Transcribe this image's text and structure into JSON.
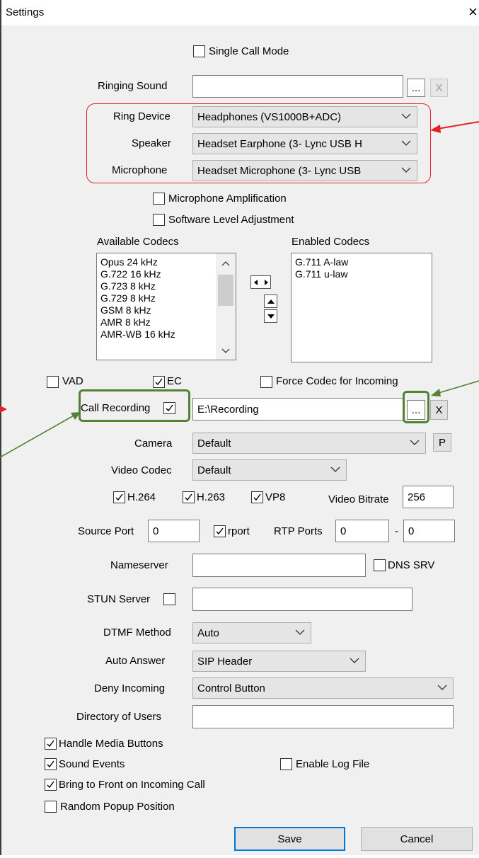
{
  "window": {
    "title": "Settings",
    "close_glyph": "×"
  },
  "single_call_mode": {
    "label": "Single Call Mode",
    "checked": false
  },
  "ringing_sound": {
    "label": "Ringing Sound",
    "value": "",
    "browse": "...",
    "clear": "X"
  },
  "ring_device": {
    "label": "Ring Device",
    "value": "Headphones (VS1000B+ADC)"
  },
  "speaker": {
    "label": "Speaker",
    "value": "Headset Earphone (3- Lync USB H"
  },
  "microphone": {
    "label": "Microphone",
    "value": "Headset Microphone (3- Lync USB"
  },
  "mic_amplification": {
    "label": "Microphone Amplification",
    "checked": false
  },
  "software_level": {
    "label": "Software Level Adjustment",
    "checked": false
  },
  "codecs": {
    "available_label": "Available Codecs",
    "enabled_label": "Enabled Codecs",
    "available": [
      "Opus 24 kHz",
      "G.722 16 kHz",
      "G.723 8 kHz",
      "G.729 8 kHz",
      "GSM 8 kHz",
      "AMR 8 kHz",
      "AMR-WB 16 kHz"
    ],
    "enabled": [
      "G.711 A-law",
      "G.711 u-law"
    ]
  },
  "vad": {
    "label": "VAD",
    "checked": false
  },
  "ec": {
    "label": "EC",
    "checked": true
  },
  "force_codec": {
    "label": "Force Codec for Incoming",
    "checked": false
  },
  "call_recording": {
    "label": "Call Recording",
    "checked": true,
    "path": "E:\\Recording",
    "browse": "...",
    "clear": "X"
  },
  "camera": {
    "label": "Camera",
    "value": "Default",
    "p_button": "P"
  },
  "video_codec": {
    "label": "Video Codec",
    "value": "Default"
  },
  "h264": {
    "label": "H.264",
    "checked": true
  },
  "h263": {
    "label": "H.263",
    "checked": true
  },
  "vp8": {
    "label": "VP8",
    "checked": true
  },
  "video_bitrate": {
    "label": "Video Bitrate",
    "value": "256"
  },
  "source_port": {
    "label": "Source Port",
    "value": "0"
  },
  "rport": {
    "label": "rport",
    "checked": true
  },
  "rtp_ports": {
    "label": "RTP Ports",
    "from": "0",
    "dash": "-",
    "to": "0"
  },
  "nameserver": {
    "label": "Nameserver",
    "value": ""
  },
  "dns_srv": {
    "label": "DNS SRV",
    "checked": false
  },
  "stun_server": {
    "label": "STUN Server",
    "checked": false,
    "value": ""
  },
  "dtmf_method": {
    "label": "DTMF Method",
    "value": "Auto"
  },
  "auto_answer": {
    "label": "Auto Answer",
    "value": "SIP Header"
  },
  "deny_incoming": {
    "label": "Deny Incoming",
    "value": "Control Button"
  },
  "directory_of_users": {
    "label": "Directory of Users",
    "value": ""
  },
  "handle_media_buttons": {
    "label": "Handle Media Buttons",
    "checked": true
  },
  "sound_events": {
    "label": "Sound Events",
    "checked": true
  },
  "enable_log_file": {
    "label": "Enable Log File",
    "checked": false
  },
  "bring_to_front": {
    "label": "Bring to Front on Incoming Call",
    "checked": true
  },
  "random_popup": {
    "label": "Random Popup Position",
    "checked": false
  },
  "buttons": {
    "save": "Save",
    "cancel": "Cancel"
  },
  "colors": {
    "red_annotation": "#e32227",
    "green_annotation": "#548235",
    "accent": "#0078d7"
  }
}
